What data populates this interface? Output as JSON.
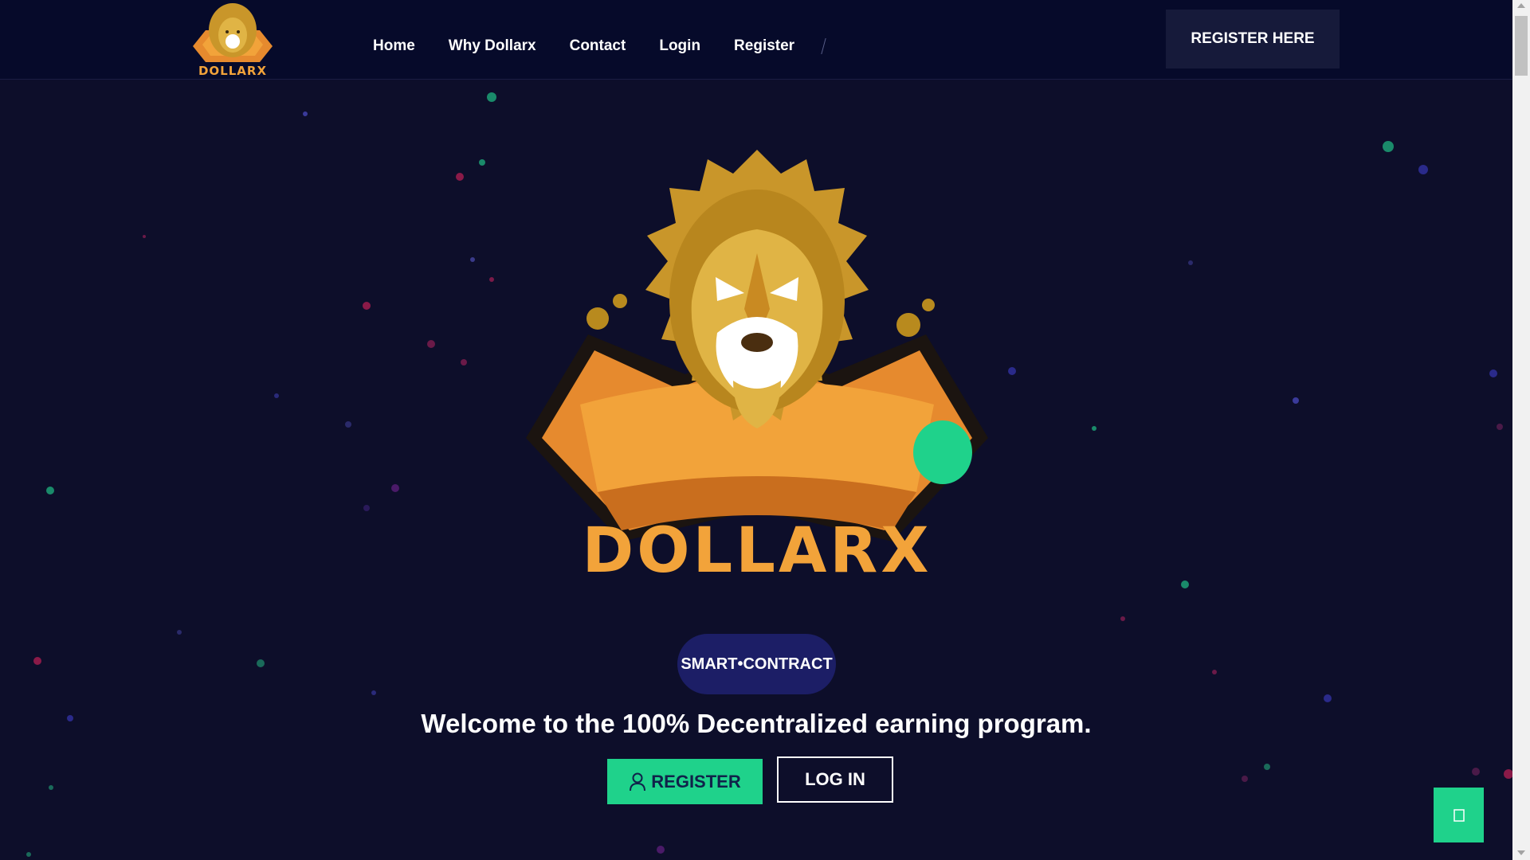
{
  "header": {
    "logo_text": "DOLLARX",
    "nav": [
      "Home",
      "Why Dollarx",
      "Contact",
      "Login",
      "Register"
    ],
    "cta_label": "REGISTER HERE"
  },
  "hero": {
    "logo_text": "DOLLARX",
    "badge": "SMART•CONTRACT",
    "welcome": "Welcome to the 100% Decentralized earning program.",
    "register_label": "REGISTER",
    "login_label": "LOG IN"
  },
  "floating_button": {
    "icon": "chat-icon"
  },
  "colors": {
    "background": "#0d0e2a",
    "header": "#060a2a",
    "accent_green": "#1fd28b",
    "brand_orange": "#f2a33a",
    "badge_blue": "#1c1e66"
  }
}
